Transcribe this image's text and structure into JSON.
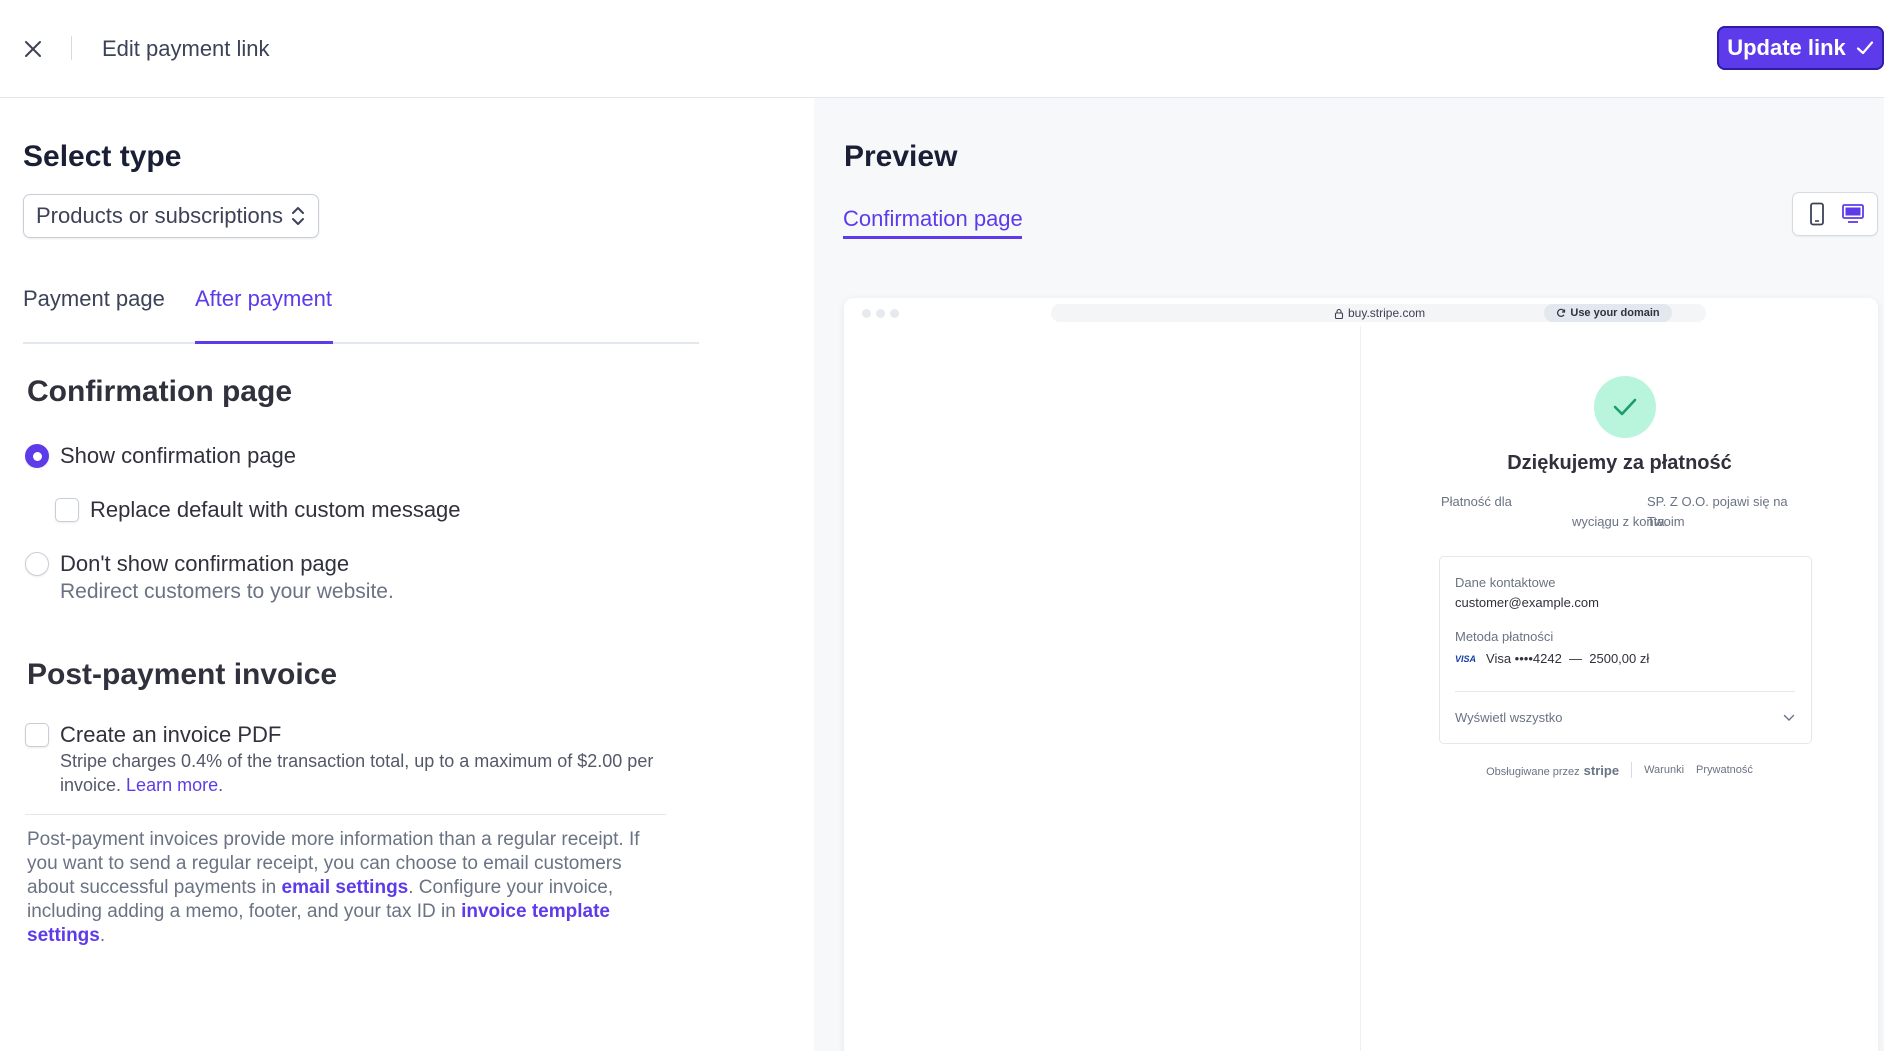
{
  "header": {
    "title": "Edit payment link",
    "update_label": "Update link"
  },
  "left": {
    "select_type_heading": "Select type",
    "type_value": "Products or subscriptions",
    "tabs": [
      {
        "label": "Payment page"
      },
      {
        "label": "After payment"
      }
    ],
    "confirmation": {
      "heading": "Confirmation page",
      "show_label": "Show confirmation page",
      "custom_message_label": "Replace default with custom message",
      "dont_show_label": "Don't show confirmation page",
      "dont_show_sub": "Redirect customers to your website."
    },
    "invoice": {
      "heading": "Post-payment invoice",
      "create_label": "Create an invoice PDF",
      "create_sub": "Stripe charges 0.4% of the transaction total, up to a maximum of $2.00 per invoice.",
      "learn_more": "Learn more",
      "info_part1": "Post-payment invoices provide more information than a regular receipt. If you want to send a regular receipt, you can choose to email customers about successful payments in",
      "email_settings_link": "email settings",
      "info_part2": ". Configure your invoice, including adding a memo, footer, and your tax ID in",
      "template_settings_link": "invoice template settings",
      "info_part3": "."
    }
  },
  "right": {
    "preview_heading": "Preview",
    "preview_tab": "Confirmation page",
    "browser": {
      "url": "buy.stripe.com",
      "domain_button": "Use your domain",
      "thanks": "Dziękujemy za płatność",
      "note_part1": "Płatność dla",
      "note_part2": "SP. Z O.O. pojawi się na Twoim",
      "note_part3": "wyciągu z konta.",
      "contact_label": "Dane kontaktowe",
      "contact_value": "customer@example.com",
      "method_label": "Metoda płatności",
      "visa_badge": "VISA",
      "method_value": "Visa ••••4242  —  2500,00 zł",
      "show_all": "Wyświetl wszystko",
      "powered_by": "Obsługiwane przez",
      "stripe": "stripe",
      "terms": "Warunki",
      "privacy": "Prywatność"
    }
  },
  "colors": {
    "accent": "#5e3bea",
    "success_bg": "#b8f5dc",
    "success_check": "#1a9e6a"
  }
}
